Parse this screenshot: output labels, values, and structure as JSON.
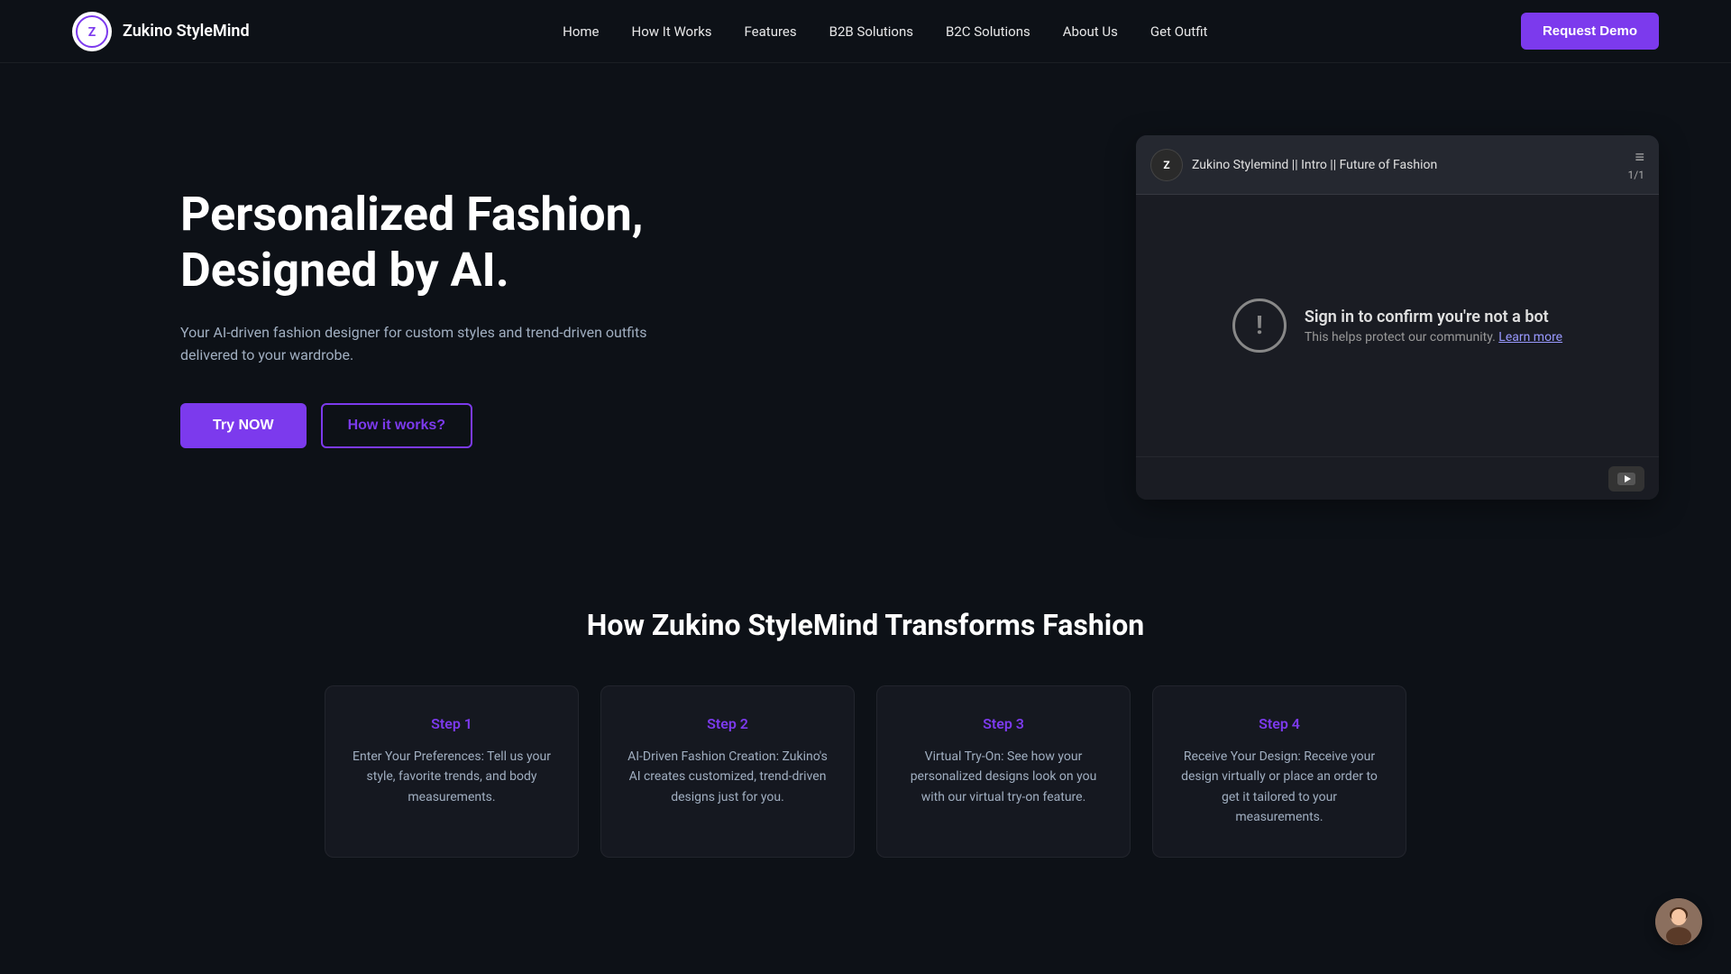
{
  "brand": {
    "name": "Zukino StyleMind"
  },
  "nav": {
    "links": [
      {
        "label": "Home",
        "id": "home"
      },
      {
        "label": "How It Works",
        "id": "how-it-works"
      },
      {
        "label": "Features",
        "id": "features"
      },
      {
        "label": "B2B Solutions",
        "id": "b2b-solutions"
      },
      {
        "label": "B2C Solutions",
        "id": "b2c-solutions"
      },
      {
        "label": "About Us",
        "id": "about-us"
      },
      {
        "label": "Get Outfit",
        "id": "get-outfit"
      }
    ],
    "request_demo_label": "Request Demo"
  },
  "hero": {
    "title": "Personalized Fashion, Designed by AI.",
    "subtitle": "Your AI-driven fashion designer for custom styles and trend-driven outfits delivered to your wardrobe.",
    "try_now_label": "Try NOW",
    "how_it_works_label": "How it works?"
  },
  "video": {
    "title": "Zukino Stylemind || Intro || Future of Fashion",
    "playlist_count": "1/1",
    "sign_in_heading": "Sign in to confirm you're not a bot",
    "sign_in_desc": "This helps protect our community.",
    "learn_more_label": "Learn more"
  },
  "section": {
    "how_title": "How Zukino StyleMind Transforms Fashion",
    "steps": [
      {
        "label": "Step 1",
        "description": "Enter Your Preferences: Tell us your style, favorite trends, and body measurements."
      },
      {
        "label": "Step 2",
        "description": "AI-Driven Fashion Creation: Zukino's AI creates customized, trend-driven designs just for you."
      },
      {
        "label": "Step 3",
        "description": "Virtual Try-On: See how your personalized designs look on you with our virtual try-on feature."
      },
      {
        "label": "Step 4",
        "description": "Receive Your Design: Receive your design virtually or place an order to get it tailored to your measurements."
      }
    ]
  },
  "colors": {
    "accent": "#7c3aed",
    "bg": "#0d1117",
    "card_bg": "#151820"
  }
}
